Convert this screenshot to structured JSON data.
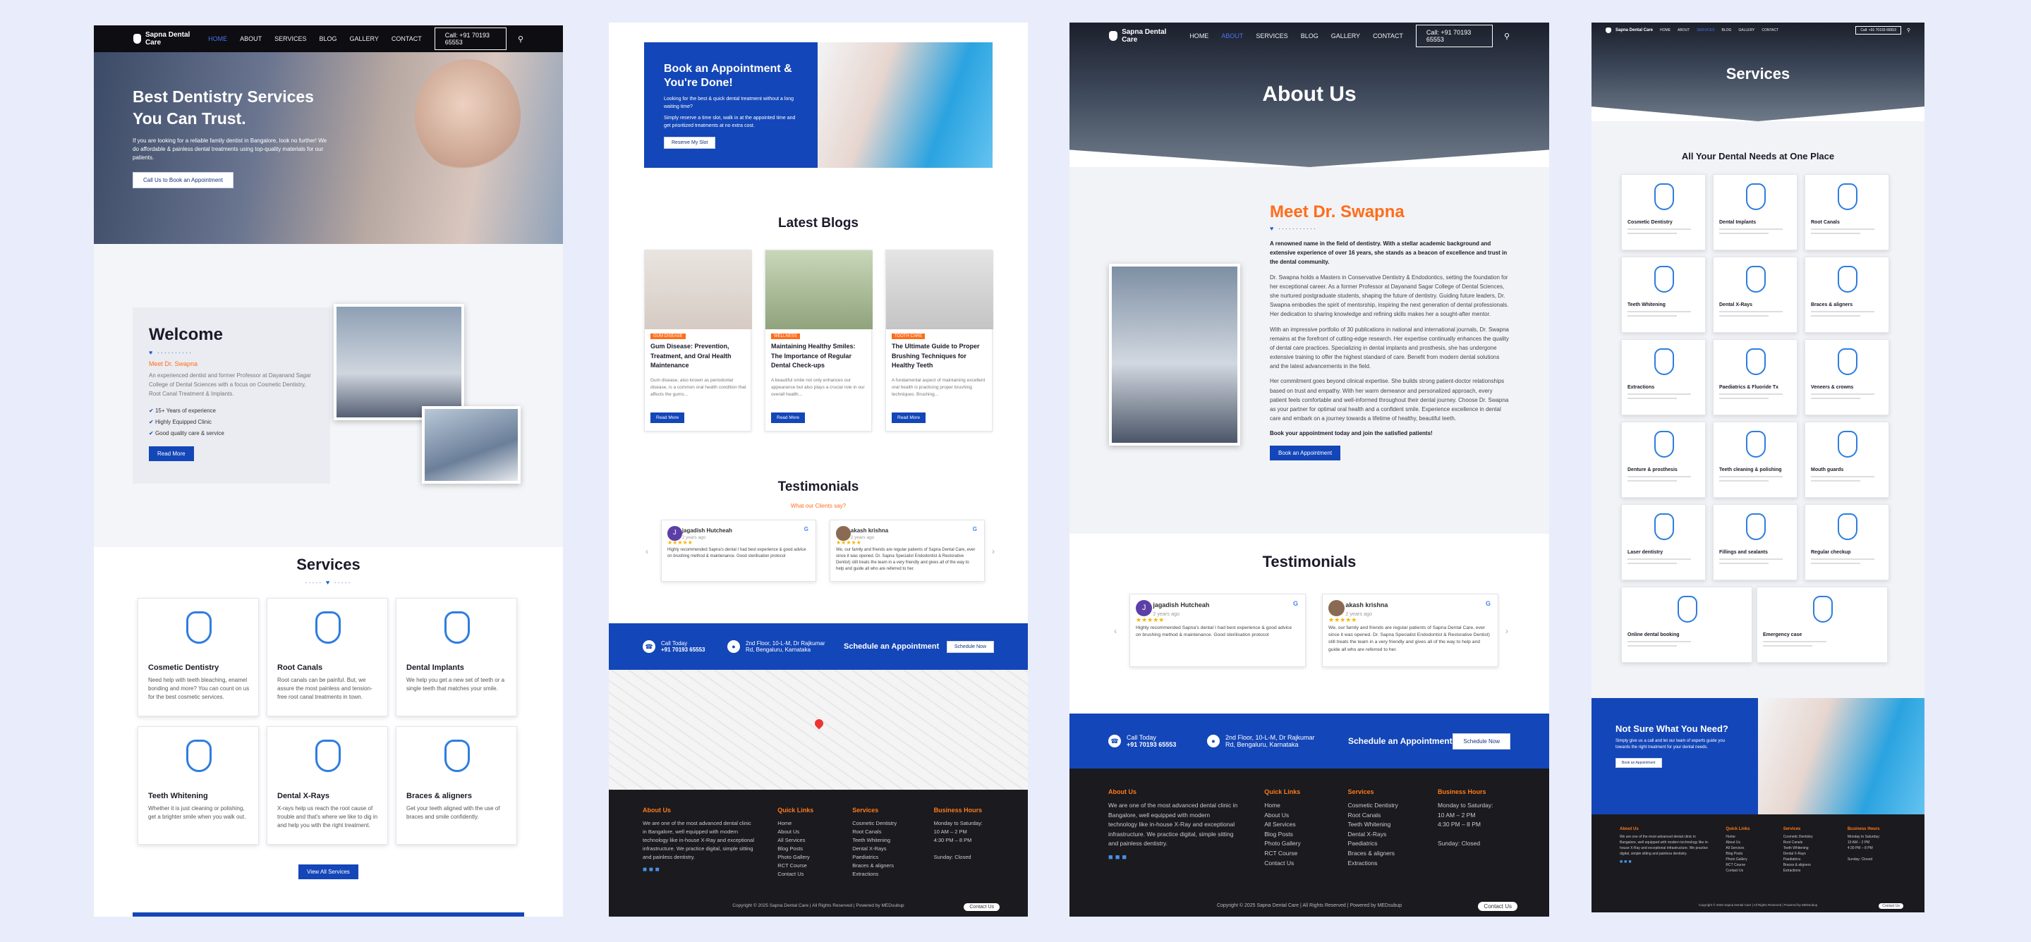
{
  "nav": {
    "brand": "Sapna Dental Care",
    "items": [
      "HOME",
      "ABOUT",
      "SERVICES",
      "BLOG",
      "GALLERY",
      "CONTACT"
    ],
    "call": "Call: +91 70193 65553"
  },
  "home": {
    "hero_title_1": "Best Dentistry Services",
    "hero_title_2": "You Can Trust.",
    "hero_text": "If you are looking for a reliable family dentist in Bangalore, look no further! We do affordable & painless dental treatments using top-quality materials for our patients.",
    "hero_btn": "Call Us to Book an Appointment",
    "welcome_title": "Welcome",
    "welcome_sub": "Meet Dr. Swapna",
    "welcome_text": "An experienced dentist and former Professor at Dayanand Sagar College of Dental Sciences with a focus on Cosmetic Dentistry, Root Canal Treatment & Implants.",
    "bullets": [
      "15+ Years of experience",
      "Highly Equipped Clinic",
      "Good quality care & service"
    ],
    "read_more": "Read More",
    "services_title": "Services",
    "services": [
      {
        "title": "Cosmetic Dentistry",
        "desc": "Need help with teeth bleaching, enamel bonding and more? You can count on us for the best cosmetic services.",
        "icon": "magnifier-tooth-icon"
      },
      {
        "title": "Root Canals",
        "desc": "Root canals can be painful. But, we assure the most painless and tension-free root canal treatments in town.",
        "icon": "root-canal-icon"
      },
      {
        "title": "Dental Implants",
        "desc": "We help you get a new set of teeth or a single teeth that matches your smile.",
        "icon": "implant-icon"
      },
      {
        "title": "Teeth Whitening",
        "desc": "Whether it is just cleaning or polishing, get a brighter smile when you walk out.",
        "icon": "sparkle-tooth-icon"
      },
      {
        "title": "Dental X-Rays",
        "desc": "X-rays help us reach the root cause of trouble and that's where we like to dig in and help you with the right treatment.",
        "icon": "xray-icon"
      },
      {
        "title": "Braces & aligners",
        "desc": "Get your teeth aligned with the use of braces and smile confidently.",
        "icon": "braces-icon"
      }
    ],
    "view_all": "View All Services"
  },
  "blog": {
    "appt_title": "Book an Appointment & You're Done!",
    "appt_text1": "Looking for the best & quick dental treatment without a long waiting time?",
    "appt_text2": "Simply reserve a time slot, walk in at the appointed time and get prioritized treatments at no extra cost.",
    "appt_btn": "Reserve My Slot",
    "latest": "Latest Blogs",
    "posts": [
      {
        "tag": "GUM DISEASE",
        "title": "Gum Disease: Prevention, Treatment, and Oral Health Maintenance",
        "excerpt": "Gum disease, also known as periodontal disease, is a common oral health condition that affects the gums...",
        "btn": "Read More"
      },
      {
        "tag": "WELLNESS",
        "title": "Maintaining Healthy Smiles: The Importance of Regular Dental Check-ups",
        "excerpt": "A beautiful smile not only enhances our appearance but also plays a crucial role in our overall health...",
        "btn": "Read More"
      },
      {
        "tag": "TOOTH CARE",
        "title": "The Ultimate Guide to Proper Brushing Techniques for Healthy Teeth",
        "excerpt": "A fundamental aspect of maintaining excellent oral health is practicing proper brushing techniques. Brushing...",
        "btn": "Read More"
      }
    ],
    "testimonials": "Testimonials",
    "what_say": "What our Clients say?",
    "reviews": [
      {
        "name": "jagadish Hutcheah",
        "date": "2 years ago",
        "text": "Highly recommended Sapna's dental I had best experience & good advice on brushing method & maintenance. Good sterilisation protocol"
      },
      {
        "name": "akash krishna",
        "date": "2 years ago",
        "text": "We, our family and friends are regular patients of Sapna Dental Care, ever since it was opened. Dr. Sapna Specialist Endodontist & Restorative Dentist) still treats the team in a very friendly and gives all of the way to help and guide all who are referred to her."
      }
    ],
    "call_today": "Call Today",
    "phone": "+91 70193 65553",
    "addr1": "2nd Floor, 10-L-M, Dr Rajkumar",
    "addr2": "Rd, Bengaluru, Karnataka",
    "schedule": "Schedule an Appointment",
    "schedule_btn": "Schedule Now"
  },
  "about": {
    "title": "About Us",
    "meet": "Meet Dr. Swapna",
    "p1": "A renowned name in the field of dentistry. With a stellar academic background and extensive experience of over 16 years, she stands as a beacon of excellence and trust in the dental community.",
    "p2": "Dr. Swapna holds a Masters in Conservative Dentistry & Endodontics, setting the foundation for her exceptional career. As a former Professor at Dayanand Sagar College of Dental Sciences, she nurtured postgraduate students, shaping the future of dentistry. Guiding future leaders, Dr. Swapna embodies the spirit of mentorship, inspiring the next generation of dental professionals. Her dedication to sharing knowledge and refining skills makes her a sought-after mentor.",
    "p3": "With an impressive portfolio of 30 publications in national and international journals, Dr. Swapna remains at the forefront of cutting-edge research. Her expertise continually enhances the quality of dental care practices. Specializing in dental implants and prosthesis, she has undergone extensive training to offer the highest standard of care. Benefit from modern dental solutions and the latest advancements in the field.",
    "p4": "Her commitment goes beyond clinical expertise. She builds strong patient-doctor relationships based on trust and empathy. With her warm demeanor and personalized approach, every patient feels comfortable and well-informed throughout their dental journey. Choose Dr. Swapna as your partner for optimal oral health and a confident smile. Experience excellence in dental care and embark on a journey towards a lifetime of healthy, beautiful teeth.",
    "p5": "Book your appointment today and join the satisfied patients!",
    "book_btn": "Book an Appointment",
    "testimonials": "Testimonials",
    "call_today": "Call Today",
    "phone": "+91 70193 65553",
    "addr1": "2nd Floor, 10-L-M, Dr Rajkumar",
    "addr2": "Rd, Bengaluru, Karnataka",
    "schedule": "Schedule an Appointment",
    "schedule_btn": "Schedule Now"
  },
  "services": {
    "title": "Services",
    "subtitle": "All Your Dental Needs at One Place",
    "items": [
      "Cosmetic Dentistry",
      "Dental Implants",
      "Root Canals",
      "Teeth Whitening",
      "Dental X-Rays",
      "Braces & aligners",
      "Extractions",
      "Paediatrics & Fluoride Tx",
      "Veneers & crowns",
      "Denture & prosthesis",
      "Teeth cleaning & polishing",
      "Mouth guards",
      "Laser dentistry",
      "Fillings and sealants",
      "Regular checkup",
      "Online dental booking",
      "Emergency case"
    ],
    "cta_title": "Not Sure What You Need?",
    "cta_text": "Simply give us a call and let our team of experts guide you towards the right treatment for your dental needs.",
    "cta_btn": "Book an Appointment"
  },
  "footer": {
    "about_h": "About Us",
    "about_t": "We are one of the most advanced dental clinic in Bangalore, well equipped with modern technology like in-house X-Ray and exceptional infrastructure. We practice digital, simple sitting and painless dentistry.",
    "links_h": "Quick Links",
    "links": [
      "Home",
      "About Us",
      "All Services",
      "Blog Posts",
      "Photo Gallery",
      "RCT Course",
      "Contact Us"
    ],
    "svc_h": "Services",
    "svc": [
      "Cosmetic Dentistry",
      "Root Canals",
      "Teeth Whitening",
      "Dental X-Rays",
      "Paediatrics",
      "Braces & aligners",
      "Extractions"
    ],
    "hours_h": "Business Hours",
    "hours": [
      "Monday to Saturday:",
      "10 AM – 2 PM",
      "4:30 PM – 8 PM",
      "",
      "Sunday: Closed"
    ],
    "copyright": "Copyright © 2025 Sapna Dental Care | All Rights Reserved | Powered by MEDsubup",
    "contact": "Contact Us"
  }
}
